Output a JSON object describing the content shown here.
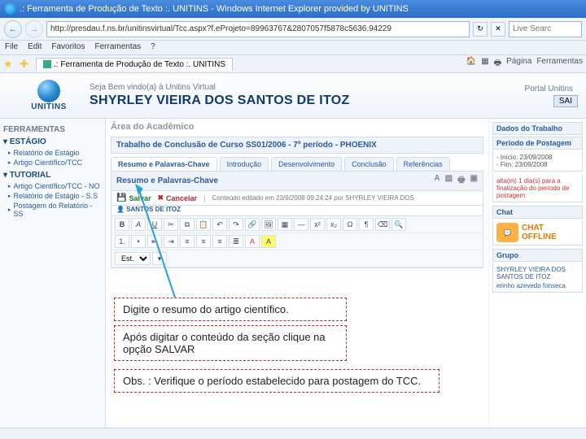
{
  "window": {
    "title": ".: Ferramenta de Produção de Texto :. UNITINS - Windows Internet Explorer provided by UNITINS"
  },
  "nav": {
    "url": "http://presdau.f.ns.br/unitinsvirtual/Tcc.aspx?f.eProjeto=89963767&2807057f5878c5636.94229",
    "search_placeholder": "Live Searc"
  },
  "menu": {
    "file": "File",
    "edit": "Edit",
    "fav": "Favoritos",
    "tools": "Ferramentas",
    "help": "?"
  },
  "tab": {
    "label": ".: Ferramenta de Produção de Texto :. UNITINS"
  },
  "toolbar_right": {
    "page": "Página",
    "tools": "Ferramentas"
  },
  "header": {
    "welcome": "Seja Bem vindo(a) à Unitins Virtual",
    "user": "SHYRLEY VIEIRA DOS SANTOS DE ITOZ",
    "portal": "Portal Unitins",
    "sair": "SAI",
    "logo": "UNITINS"
  },
  "sidebar": {
    "tools": "FERRAMENTAS",
    "estagio": "ESTÁGIO",
    "links_estagio": [
      "Relatório de Estágio",
      "Artigo Científico/TCC"
    ],
    "tutorial": "TUTORIAL",
    "links_tutorial": [
      "Artigo Científico/TCC - NO",
      "Relatório de Estágio - S.S",
      "Postagem do Relatório - SS"
    ]
  },
  "center": {
    "area": "Área do Acadêmico",
    "course": "Trabalho de Conclusão de Curso SS01/2006 - 7º período - PHOENIX",
    "tabs": [
      "Resumo e Palavras-Chave",
      "Introdução",
      "Desenvolvimento",
      "Conclusão",
      "Referências"
    ],
    "subtitle": "Resumo e Palavras-Chave",
    "save": "Salvar",
    "cancel": "Cancelar",
    "edited": "Conteúdo editado em 23/9/2008 09:24:24 por SHYRLEY VIEIRA DOS",
    "acad": "SANTOS DE ITOZ",
    "est": "Est."
  },
  "right": {
    "dados": "Dados do Trabalho",
    "periodo": "Período de Postagem",
    "inicio_lbl": "- Início:",
    "inicio": "23/09/2008",
    "fim_lbl": "- Fim:",
    "fim": "23/09/2008",
    "alerta": "alta(m) 1 dia(s) para a finalização do período de postagem",
    "chat": "Chat",
    "chat_off": "CHAT OFFLINE",
    "grupo": "Grupo",
    "g1": "SHYRLEY VIEIRA DOS SANTOS DE ITOZ",
    "g2": "erinho azevedo fonseca"
  },
  "callouts": {
    "c1": "Digite o resumo do artigo científico.",
    "c2": "Após digitar o conteúdo da seção clique na opção SALVAR",
    "c3": "Obs. : Verifique o período estabelecido para postagem do TCC."
  }
}
